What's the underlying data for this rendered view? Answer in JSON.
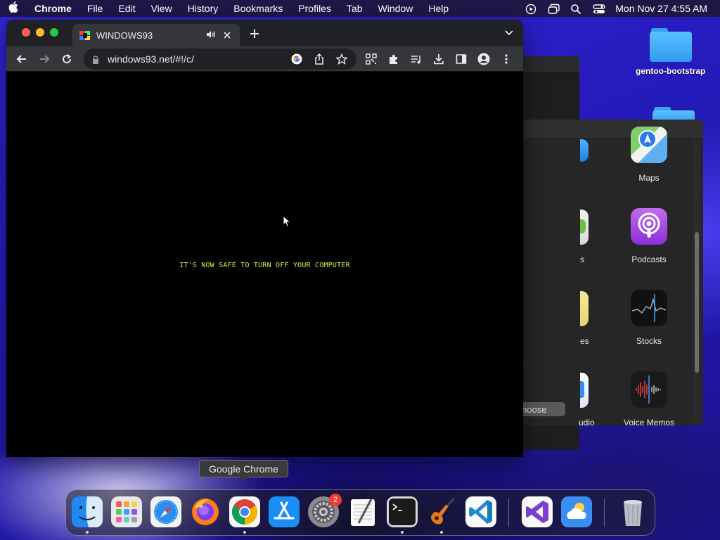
{
  "menubar": {
    "app_name": "Chrome",
    "items": [
      "File",
      "Edit",
      "View",
      "History",
      "Bookmarks",
      "Profiles",
      "Tab",
      "Window",
      "Help"
    ],
    "clock": "Mon Nov 27  4:55 AM"
  },
  "desktop": {
    "folders": [
      {
        "label": "gentoo-bootstrap"
      },
      {
        "label": ""
      }
    ]
  },
  "bg_window": {
    "apps": [
      {
        "label": "Maps",
        "icon": "maps-icon"
      },
      {
        "label": "Podcasts",
        "icon": "podcasts-icon"
      },
      {
        "label": "Stocks",
        "icon": "stocks-icon"
      },
      {
        "label": "Voice Memos",
        "icon": "voice-memos-icon"
      }
    ],
    "partial_labels": [
      "s",
      "es",
      "udio"
    ],
    "choose_button": "hoose"
  },
  "chrome": {
    "tab_title": "WINDOWS93",
    "url": "windows93.net/#!/c/",
    "page_message": "IT'S NOW SAFE TO TURN OFF YOUR COMPUTER"
  },
  "dock": {
    "tooltip": "Google Chrome",
    "apps": [
      {
        "name": "Finder",
        "icon": "finder-icon",
        "running": true
      },
      {
        "name": "Launchpad",
        "icon": "launchpad-icon",
        "running": false
      },
      {
        "name": "Safari",
        "icon": "safari-icon",
        "running": false
      },
      {
        "name": "Firefox",
        "icon": "firefox-icon",
        "running": false
      },
      {
        "name": "Google Chrome",
        "icon": "chrome-icon",
        "running": true
      },
      {
        "name": "App Store",
        "icon": "app-store-icon",
        "running": false
      },
      {
        "name": "System Preferences",
        "icon": "system-preferences-icon",
        "running": false,
        "badge": "2"
      },
      {
        "name": "TextEdit",
        "icon": "textedit-icon",
        "running": false
      },
      {
        "name": "Terminal",
        "icon": "terminal-icon",
        "running": true
      },
      {
        "name": "GarageBand",
        "icon": "garageband-icon",
        "running": true
      },
      {
        "name": "Visual Studio Code",
        "icon": "vscode-icon",
        "running": false
      },
      {
        "name": "Visual Studio",
        "icon": "visual-studio-icon",
        "running": false
      },
      {
        "name": "Weather",
        "icon": "weather-icon",
        "running": false
      },
      {
        "name": "Trash",
        "icon": "trash-icon",
        "running": false
      }
    ]
  }
}
